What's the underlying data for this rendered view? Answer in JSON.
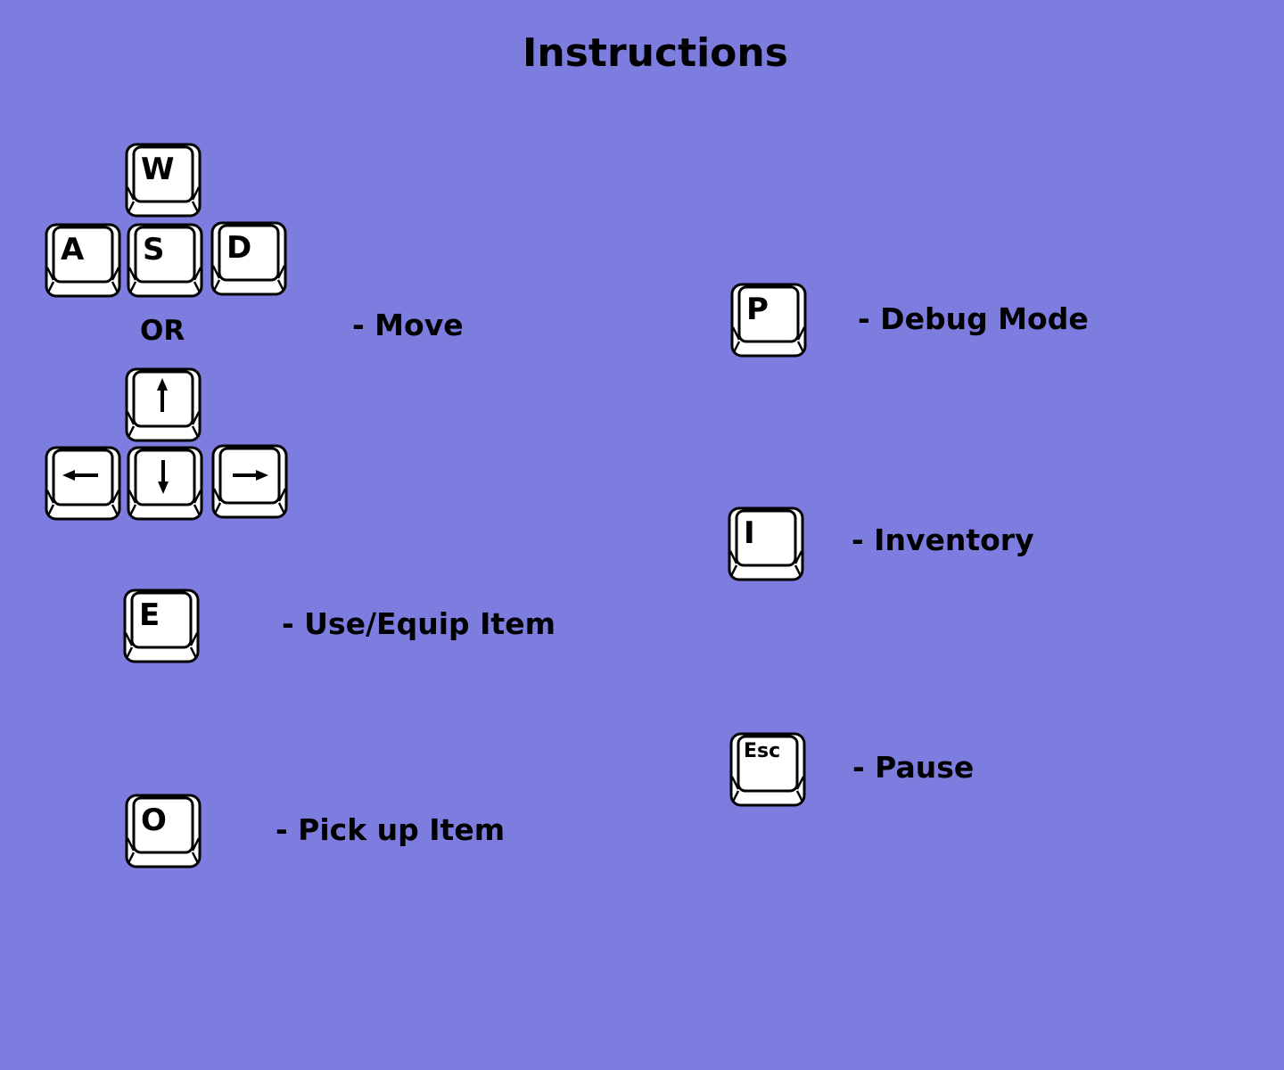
{
  "page": {
    "title": "Instructions",
    "background_color": "#7d7ddf"
  },
  "keys": {
    "w": "W",
    "a": "A",
    "s": "S",
    "d": "D",
    "e": "E",
    "o": "O",
    "p": "P",
    "i": "I",
    "esc": "Esc",
    "arrow_up": "arrow-up-icon",
    "arrow_left": "arrow-left-icon",
    "arrow_down": "arrow-down-icon",
    "arrow_right": "arrow-right-icon"
  },
  "or_text": "OR",
  "actions": {
    "move": "- Move",
    "use_equip": "- Use/Equip Item",
    "pick_up": "- Pick up Item",
    "debug": "- Debug Mode",
    "inventory": "- Inventory",
    "pause": "- Pause"
  }
}
